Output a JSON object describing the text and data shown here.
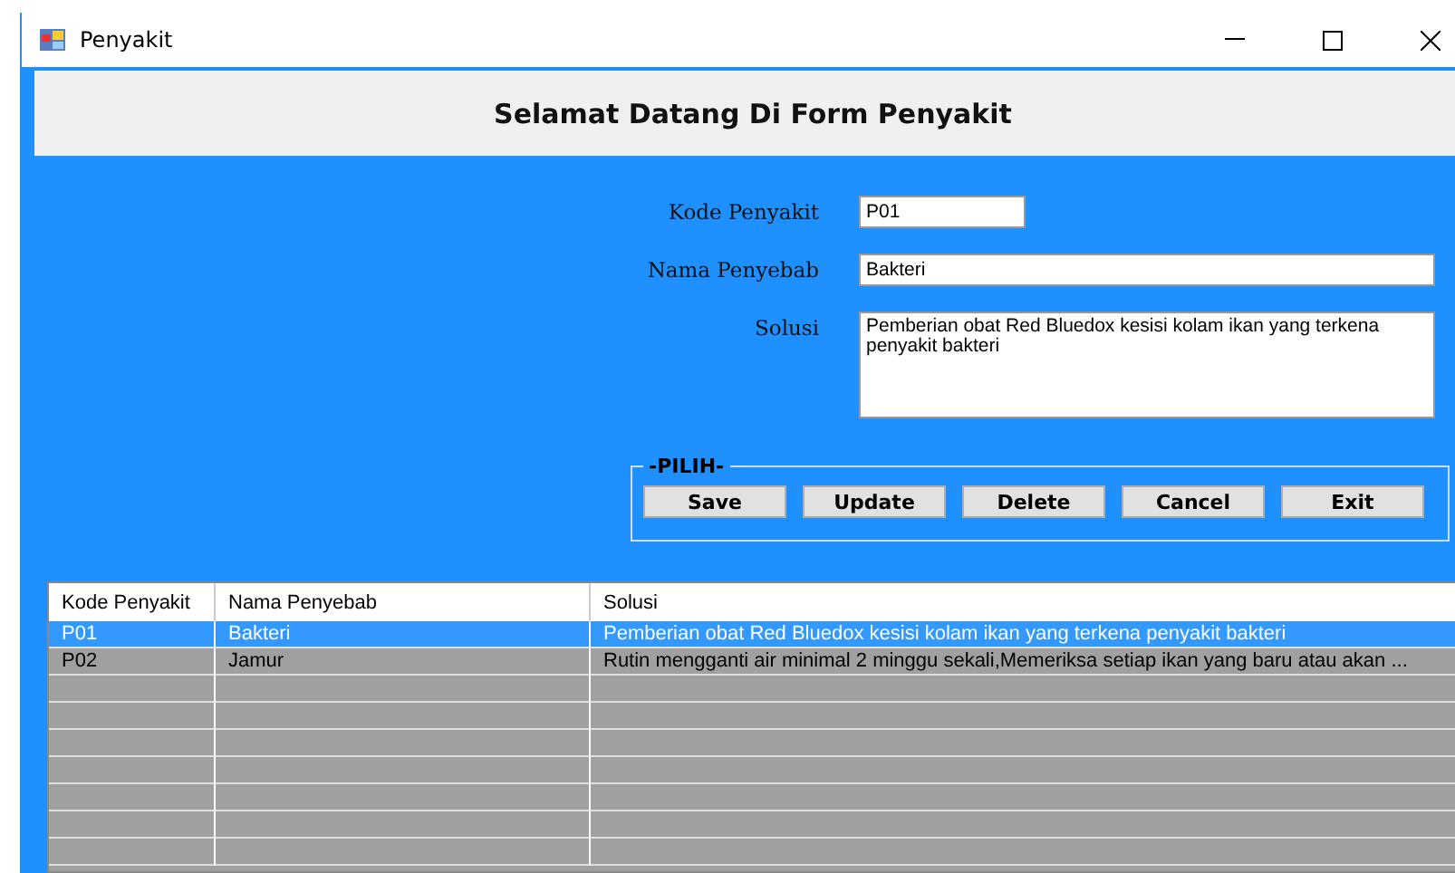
{
  "window": {
    "title": "Penyakit"
  },
  "header": {
    "title": "Selamat Datang Di Form Penyakit"
  },
  "form": {
    "fields": [
      {
        "label": "Kode Penyakit",
        "value": "P01",
        "kind": "short"
      },
      {
        "label": "Nama Penyebab",
        "value": "Bakteri",
        "kind": "wide"
      },
      {
        "label": "Solusi",
        "value": "Pemberian obat Red Bluedox  kesisi kolam ikan yang terkena penyakit bakteri",
        "kind": "multiline"
      }
    ]
  },
  "group": {
    "title": "-PILIH-",
    "buttons": [
      "Save",
      "Update",
      "Delete",
      "Cancel",
      "Exit"
    ]
  },
  "table": {
    "columns": [
      "Kode Penyakit",
      "Nama Penyebab",
      "Solusi"
    ],
    "rows": [
      {
        "cells": [
          "P01",
          "Bakteri",
          "Pemberian obat Red Bluedox  kesisi kolam ikan yang terkena penyakit bakteri"
        ],
        "selected": true
      },
      {
        "cells": [
          "P02",
          "Jamur",
          "Rutin mengganti air minimal 2 minggu sekali,Memeriksa setiap ikan yang baru atau akan ..."
        ],
        "selected": false
      }
    ]
  }
}
